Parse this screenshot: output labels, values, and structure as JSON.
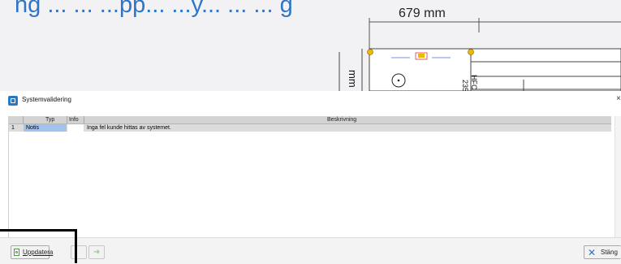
{
  "background": {
    "headline": "ng ... ... ...pp... ...y... ... ... g",
    "dimension_label": "679 mm",
    "vertical_label_mm": "mm",
    "vertical_label_235": "235",
    "vertical_label_hfc": "HFC"
  },
  "dialog": {
    "title": "Systemvalidering",
    "close_glyph": "×",
    "columns": {
      "row_num": "",
      "typ": "Typ",
      "info": "Info",
      "beskrivning": "Beskrivning"
    },
    "rows": [
      {
        "num": "1",
        "typ": "Notis",
        "info": "",
        "beskrivning": "Inga fel kunde hittas av systemet."
      }
    ]
  },
  "toolbar": {
    "update_label": "Uppdatera",
    "update_icon": "refresh-document-icon",
    "back_icon": "arrow-left-icon",
    "forward_icon": "arrow-right-icon",
    "close_label": "Stäng",
    "close_icon": "close-x-icon"
  },
  "colors": {
    "accent": "#2e75c9",
    "selected_cell": "#9fc4ee",
    "header_bg": "#d3d3d3",
    "row_bg": "#dcdcdc",
    "highlight": "#000000"
  }
}
